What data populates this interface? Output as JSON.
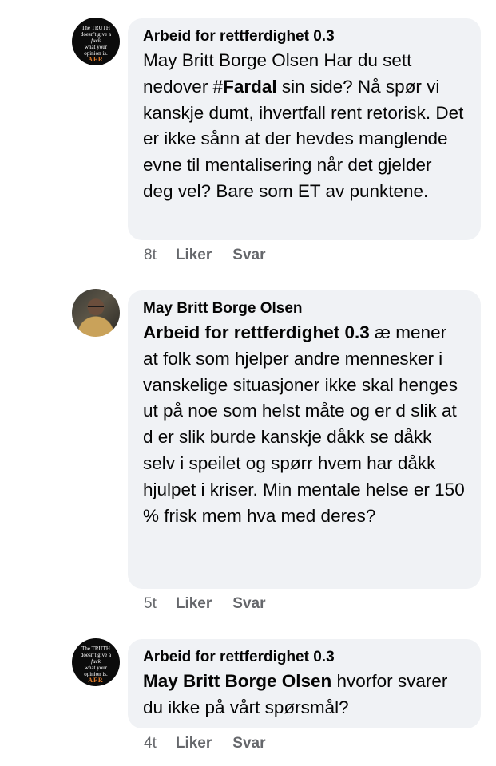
{
  "comments": [
    {
      "author": "Arbeid for rettferdighet 0.3",
      "avatar": {
        "type": "text-logo",
        "lines": [
          "The TRUTH",
          "doesn't give a",
          "fuck",
          "what your",
          "opinion is.",
          "AFR"
        ]
      },
      "body_before": "May Britt Borge Olsen Har du sett nedover #",
      "mention": "Fardal",
      "body_after": " sin side? Nå spør vi kanskje dumt, ihvertfall rent retorisk. Det er ikke sånn at der hevdes manglende evne til mentalisering når det gjelder deg vel? Bare som ET av punktene.",
      "time": "8t",
      "like": "Liker",
      "reply": "Svar"
    },
    {
      "author": "May Britt Borge Olsen",
      "avatar": {
        "type": "photo"
      },
      "mention": "Arbeid for rettferdighet 0.3",
      "body_after": " æ mener at folk som hjelper andre mennesker i vanskelige situasjoner ikke skal henges ut på noe som helst måte og er d slik at d er slik burde kanskje dåkk se dåkk selv i speilet og spørr hvem har dåkk hjulpet i kriser. Min mentale helse er 150 % frisk mem hva med deres?",
      "time": "5t",
      "like": "Liker",
      "reply": "Svar"
    },
    {
      "author": "Arbeid for rettferdighet 0.3",
      "avatar": {
        "type": "text-logo",
        "lines": [
          "The TRUTH",
          "doesn't give a",
          "fuck",
          "what your",
          "opinion is.",
          "AFR"
        ]
      },
      "mention": "May Britt Borge Olsen",
      "body_after": " hvorfor svarer du ikke på vårt spørsmål?",
      "time": "4t",
      "like": "Liker",
      "reply": "Svar"
    }
  ]
}
